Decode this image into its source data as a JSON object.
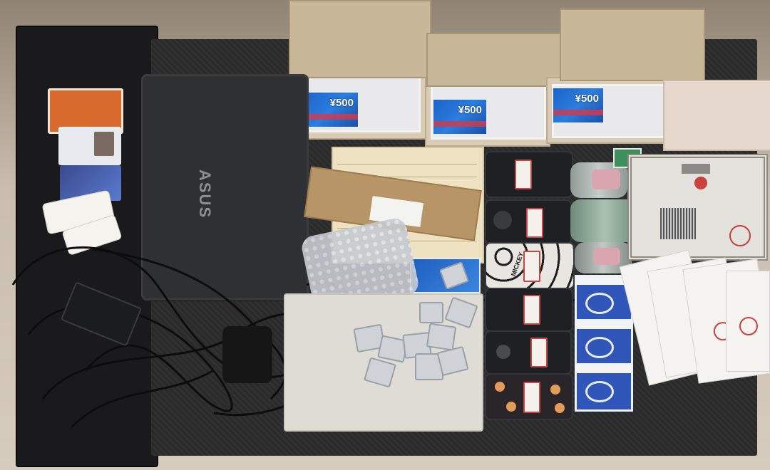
{
  "laptop": {
    "brand": "ASUS"
  },
  "recharge_cards": [
    {
      "amount": "¥500"
    },
    {
      "amount": "¥500"
    },
    {
      "amount": "¥500"
    }
  ],
  "phone_case_text": "MICKEY",
  "colors": {
    "recharge_card_blue": "#2b7de0",
    "boxed_card_blue": "#2f56b8",
    "sim_orange": "#d96a2e",
    "tag_border_red": "#c24848"
  }
}
